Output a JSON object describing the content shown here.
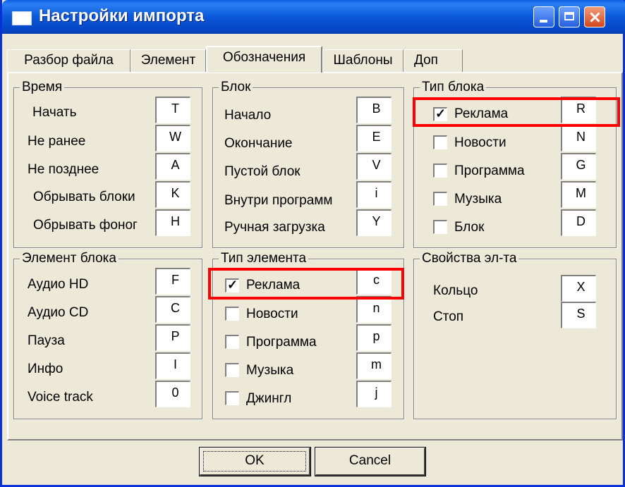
{
  "window": {
    "title": "Настройки импорта"
  },
  "tabs": [
    "Разбор файла",
    "Элемент",
    "Обозначения",
    "Шаблоны",
    "Доп"
  ],
  "groups": {
    "time": {
      "title": "Время",
      "items": [
        {
          "label": "Начать",
          "value": "T"
        },
        {
          "label": "Не ранее",
          "value": "W"
        },
        {
          "label": "Не позднее",
          "value": "A"
        },
        {
          "label": "Обрывать блоки",
          "value": "K"
        },
        {
          "label": "Обрывать фоног",
          "value": "H"
        }
      ]
    },
    "block": {
      "title": "Блок",
      "items": [
        {
          "label": "Начало",
          "value": "B"
        },
        {
          "label": "Окончание",
          "value": "E"
        },
        {
          "label": "Пустой блок",
          "value": "V"
        },
        {
          "label": "Внутри программ",
          "value": "i"
        },
        {
          "label": "Ручная загрузка",
          "value": "Y"
        }
      ]
    },
    "block_type": {
      "title": "Тип блока",
      "items": [
        {
          "label": "Реклама",
          "value": "R",
          "checked": true
        },
        {
          "label": "Новости",
          "value": "N",
          "checked": false
        },
        {
          "label": "Программа",
          "value": "G",
          "checked": false
        },
        {
          "label": "Музыка",
          "value": "M",
          "checked": false
        },
        {
          "label": "Блок",
          "value": "D",
          "checked": false
        }
      ]
    },
    "block_element": {
      "title": "Элемент блока",
      "items": [
        {
          "label": "Аудио HD",
          "value": "F"
        },
        {
          "label": "Аудио CD",
          "value": "C"
        },
        {
          "label": "Пауза",
          "value": "P"
        },
        {
          "label": "Инфо",
          "value": "I"
        },
        {
          "label": "Voice track",
          "value": "0"
        }
      ]
    },
    "element_type": {
      "title": "Тип элемента",
      "items": [
        {
          "label": "Реклама",
          "value": "c",
          "checked": true
        },
        {
          "label": "Новости",
          "value": "n",
          "checked": false
        },
        {
          "label": "Программа",
          "value": "p",
          "checked": false
        },
        {
          "label": "Музыка",
          "value": "m",
          "checked": false
        },
        {
          "label": "Джингл",
          "value": "j",
          "checked": false
        }
      ]
    },
    "element_props": {
      "title": "Свойства эл-та",
      "items": [
        {
          "label": "Кольцо",
          "value": "X"
        },
        {
          "label": "Стоп",
          "value": "S"
        }
      ]
    }
  },
  "buttons": {
    "ok": "OK",
    "cancel": "Cancel"
  },
  "colors": {
    "highlight": "#ff0000",
    "titlebar": "#0a58d8",
    "face": "#ece9d8"
  }
}
